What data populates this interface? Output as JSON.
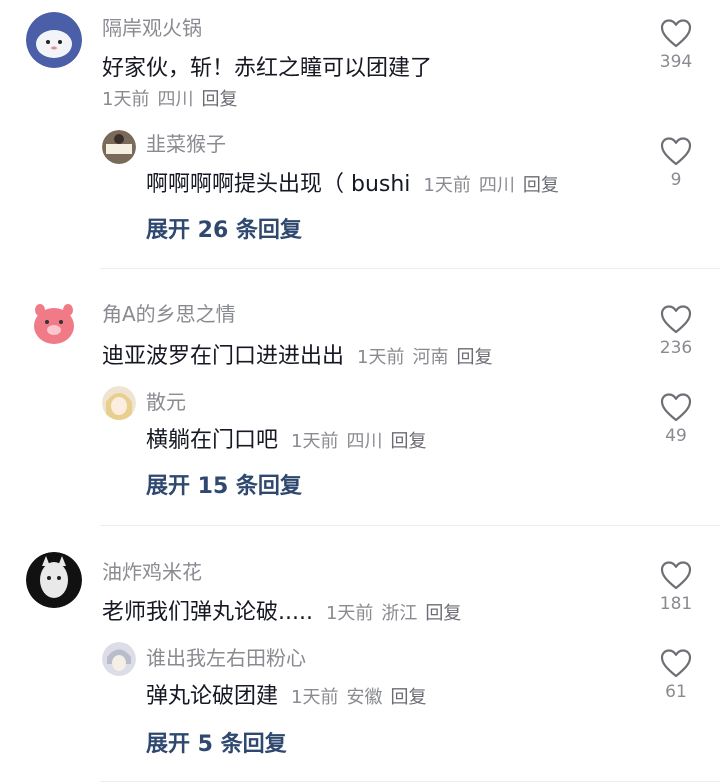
{
  "comments": [
    {
      "username": "隔岸观火锅",
      "text": "好家伙，斩！赤红之瞳可以团建了",
      "time": "1天前",
      "location": "四川",
      "reply_label": "回复",
      "likes": "394",
      "reply": {
        "username": "韭菜猴子",
        "text": "啊啊啊啊提头出现（ bushi",
        "time": "1天前",
        "location": "四川",
        "reply_label": "回复",
        "likes": "9"
      },
      "expand_label": "展开 26 条回复"
    },
    {
      "username": "角A的乡思之情",
      "text": "迪亚波罗在门口进进出出",
      "time": "1天前",
      "location": "河南",
      "reply_label": "回复",
      "likes": "236",
      "reply": {
        "username": "散元",
        "text": "横躺在门口吧",
        "time": "1天前",
        "location": "四川",
        "reply_label": "回复",
        "likes": "49"
      },
      "expand_label": "展开 15 条回复"
    },
    {
      "username": "油炸鸡米花",
      "text": "老师我们弹丸论破.....",
      "time": "1天前",
      "location": "浙江",
      "reply_label": "回复",
      "likes": "181",
      "reply": {
        "username": "谁出我左右田粉心",
        "text": "弹丸论破团建",
        "time": "1天前",
        "location": "安徽",
        "reply_label": "回复",
        "likes": "61"
      },
      "expand_label": "展开 5 条回复"
    }
  ],
  "colors": {
    "text": "#161823",
    "meta": "#8a8b91",
    "expand": "#2f4870",
    "divider": "#ececee"
  },
  "icons": {
    "like": "heart-outline-icon"
  }
}
